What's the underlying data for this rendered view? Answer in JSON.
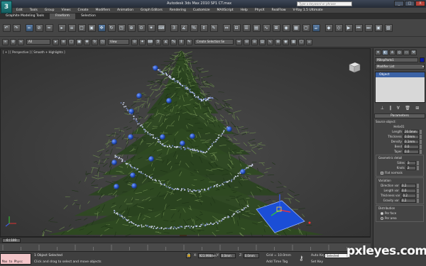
{
  "window": {
    "title": "Autodesk 3ds Max 2010 SP1        CT.max",
    "search_placeholder": "Type a keyword or phrase",
    "logo_glyph": "3",
    "buttons": [
      "_",
      "□",
      "X"
    ]
  },
  "menu": [
    "Edit",
    "Tools",
    "Group",
    "Views",
    "Create",
    "Modifiers",
    "Animation",
    "Graph Editors",
    "Rendering",
    "Customize",
    "MAXScript",
    "Help",
    "PhysX",
    "RealFlow",
    "V-Ray 1.5 Ultimate"
  ],
  "ribbon_tabs": [
    {
      "label": "Graphite Modeling Tools",
      "active": false
    },
    {
      "label": "Freeform",
      "active": true
    },
    {
      "label": "Selection",
      "active": false
    }
  ],
  "toolbar": {
    "filter_value": "All",
    "view_value": "View",
    "named_selection_placeholder": "Create Selection Se"
  },
  "viewport": {
    "label": "[ + ] [ Perspective ] [ Smooth + Highlights ]",
    "colors": {
      "background": "#3d3d3d",
      "gizmo_plane": "#1b4ed6",
      "ornament": "#2c57c9",
      "tinsel": "#cfd6ea",
      "foliage": "#2f4a22"
    }
  },
  "command_panel": {
    "object_name": "PBlepParts1",
    "object_color": "#0b1aa6",
    "modifier_list": "Modifier List",
    "stack_item": "Object",
    "parameters_title": "Parameters",
    "source_object_label": "Source object:",
    "source_object_value": "Helix01",
    "params": [
      {
        "label": "Length",
        "value": "20.0mm"
      },
      {
        "label": "Thickness",
        "value": "0.0mm"
      },
      {
        "label": "Density",
        "value": "0.1mm"
      },
      {
        "label": "Bend",
        "value": "0.0"
      },
      {
        "label": "Taper",
        "value": "0.0"
      }
    ],
    "geometric_detail_title": "Geometric detail",
    "detail_params": [
      {
        "label": "Sides",
        "value": "3"
      },
      {
        "label": "Knots",
        "value": "2"
      }
    ],
    "flat_normals_label": "Flat normals",
    "variation_title": "Variation",
    "variation_params": [
      {
        "label": "Direction var",
        "value": "0.2"
      },
      {
        "label": "Length var",
        "value": "0.0"
      },
      {
        "label": "Thickness var",
        "value": "0.2"
      },
      {
        "label": "Gravity var",
        "value": "0.2"
      }
    ],
    "distribution_title": "Distribution",
    "distribution_options": [
      {
        "label": "Per face",
        "selected": true
      },
      {
        "label": "Per area",
        "selected": false
      }
    ]
  },
  "timeline": {
    "thumb_text": "0 / 100"
  },
  "status": {
    "listener_text": "Max to Physc",
    "line1": "1 Object Selected",
    "line2": "Click and drag to select and move objects",
    "x_label": "X:",
    "x_value": "923.998mm",
    "y_label": "Y:",
    "y_value": "0.0mm",
    "z_label": "Z:",
    "z_value": "0.0mm",
    "grid_text": "Grid = 10.0mm",
    "add_time_tag": "Add Time Tag",
    "autokey_label": "Auto Key",
    "setkey_label": "Set Key",
    "selected_value": "Selected"
  },
  "watermark": {
    "text": "pxleyes.com"
  }
}
